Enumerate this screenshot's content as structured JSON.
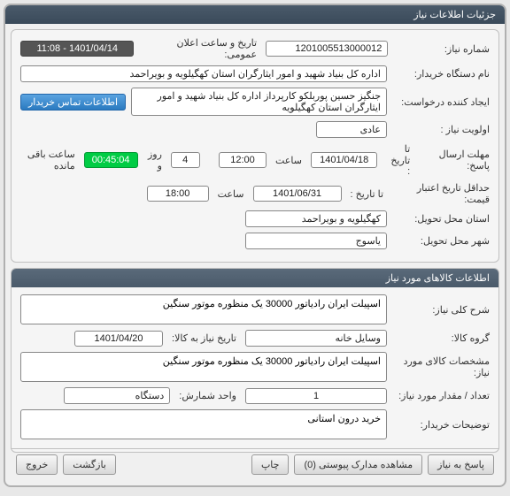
{
  "titleBar": "جزئیات اطلاعات نیاز",
  "info": {
    "labels": {
      "needNumber": "شماره نیاز:",
      "announceDate": "تاریخ و ساعت اعلان عمومی:",
      "buyerOrg": "نام دستگاه خریدار:",
      "requestCreator": "ایجاد کننده درخواست:",
      "priority": "اولویت نیاز :",
      "replyDeadline": "مهلت ارسال پاسخ:",
      "toDate": "تا تاریخ :",
      "time": "ساعت",
      "and": "و",
      "days": "روز و",
      "remaining": "ساعت باقی مانده",
      "minPriceValidity": "حداقل تاریخ اعتبار قیمت:",
      "deliveryProvince": "استان محل تحویل:",
      "deliveryCity": "شهر محل تحویل:",
      "contactBtn": "اطلاعات تماس خریدار"
    },
    "values": {
      "needNumber": "1201005513000012",
      "announceDate": "1401/04/14 - 11:08",
      "buyerOrg": "اداره کل بنیاد شهید و امور ایثارگران استان کهگیلویه و بویراحمد",
      "requestCreator": "جنگیز حسین پوربلکو کارپرداز اداره کل بنیاد شهید و امور ایثارگران استان کهگیلویه",
      "priority": "عادی",
      "deadlineDate": "1401/04/18",
      "deadlineTime": "12:00",
      "daysLeft": "4",
      "timeLeft": "00:45:04",
      "validityDate": "1401/06/31",
      "validityTime": "18:00",
      "deliveryProvince": "کهگیلویه و بویراحمد",
      "deliveryCity": "یاسوج"
    }
  },
  "goods": {
    "header": "اطلاعات کالاهای مورد نیاز",
    "labels": {
      "generalDesc": "شرح کلی نیاز:",
      "goodsGroup": "گروه کالا:",
      "needDate": "تاریخ نیاز به کالا:",
      "goodsSpec": "مشخصات کالای مورد نیاز:",
      "quantity": "تعداد / مقدار مورد نیاز:",
      "unit": "واحد شمارش:",
      "buyerNotes": "توضیحات خریدار:"
    },
    "values": {
      "generalDesc": "اسپیلت ایران رادیاتور 30000 یک منظوره موتور سنگین",
      "goodsGroup": "وسایل خانه",
      "needDate": "1401/04/20",
      "goodsSpec": "اسپیلت ایران رادیاتور 30000 یک منظوره موتور سنگین",
      "quantity": "1",
      "unit": "دستگاه",
      "buyerNotes": "خرید درون استانی"
    }
  },
  "footer": {
    "reply": "پاسخ به نیاز",
    "attachments": "مشاهده مدارک پیوستی (0)",
    "print": "چاپ",
    "back": "بازگشت",
    "exit": "خروج"
  }
}
